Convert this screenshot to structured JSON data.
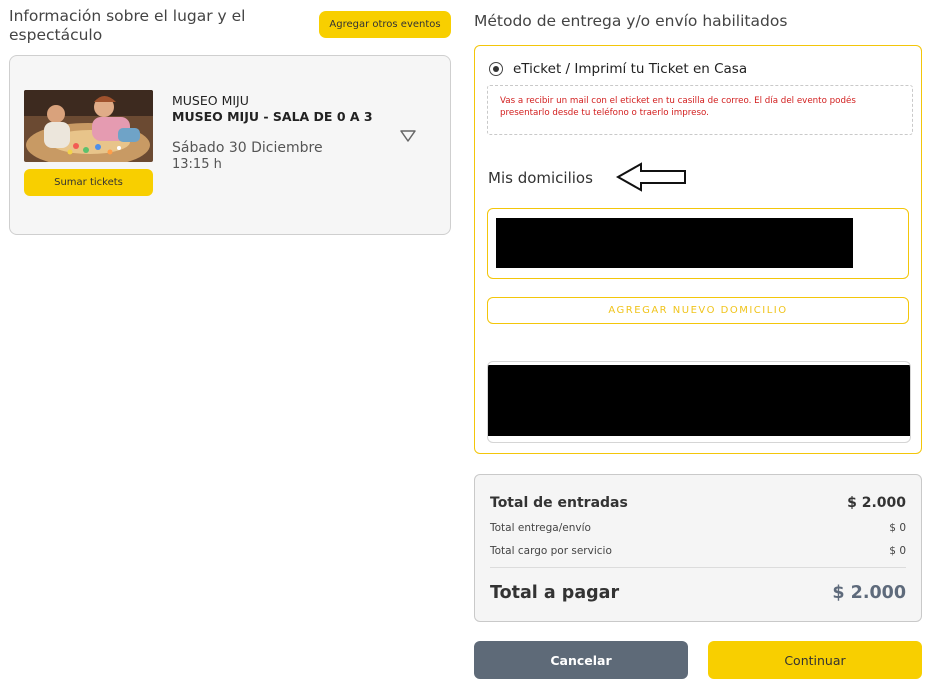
{
  "left": {
    "title": "Información sobre el lugar y el espectáculo",
    "add_events_label": "Agregar otros eventos",
    "event": {
      "venue": "MUSEO MIJU",
      "show": "MUSEO MIJU - SALA DE 0 A 3",
      "date": "Sábado 30 Diciembre",
      "time": "13:15 h",
      "add_tickets_label": "Sumar tickets",
      "expand_icon": "chevron-down-icon"
    }
  },
  "delivery": {
    "title": "Método de entrega y/o envío habilitados",
    "option_label": "eTicket / Imprimí tu Ticket en Casa",
    "option_selected": true,
    "option_note": "Vas a recibir un mail con el eticket en tu casilla de correo. El día del evento podés presentarlo desde tu teléfono o traerlo impreso.",
    "addresses_title": "Mis domicilios",
    "new_address_label": "AGREGAR NUEVO DOMICILIO"
  },
  "totals": {
    "entradas_label": "Total de entradas",
    "entradas_value": "$ 2.000",
    "envio_label": "Total entrega/envío",
    "envio_value": "$ 0",
    "cargo_label": "Total cargo por servicio",
    "cargo_value": "$ 0",
    "pagar_label": "Total a pagar",
    "pagar_value": "$ 2.000"
  },
  "actions": {
    "cancel_label": "Cancelar",
    "continue_label": "Continuar"
  },
  "colors": {
    "accent": "#f8cf00",
    "cancel": "#5e6a78",
    "note_text": "#d21f1f",
    "total_value": "#5e6a7b"
  }
}
